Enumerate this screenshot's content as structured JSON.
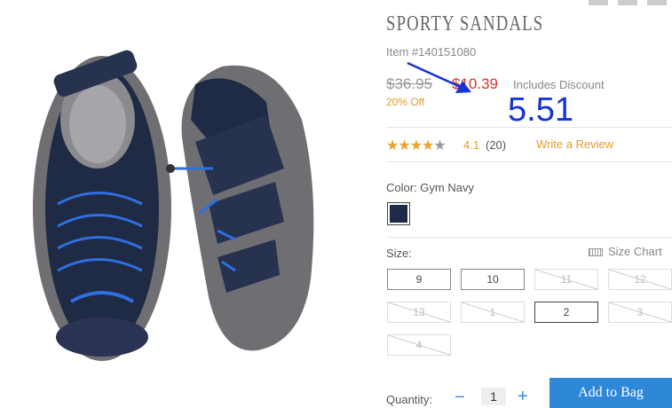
{
  "product": {
    "title": "SPORTY SANDALS",
    "item_number": "Item #140151080",
    "original_price": "$36.95",
    "sale_price": "$10.39",
    "discount_note": "Includes Discount",
    "percent_off": "20% Off",
    "rating_value": "4.1",
    "rating_count": "(20)",
    "rating_fraction": 0.82,
    "write_review_label": "Write a Review"
  },
  "annotation": {
    "text": "5.51",
    "color": "#1533d6"
  },
  "color": {
    "label": "Color: Gym Navy",
    "swatch_hex": "#1e2a48"
  },
  "sizes": {
    "label": "Size:",
    "chart_label": "Size Chart",
    "options": [
      {
        "label": "9",
        "available": true
      },
      {
        "label": "10",
        "available": true
      },
      {
        "label": "11",
        "available": false
      },
      {
        "label": "12",
        "available": false
      },
      {
        "label": "13",
        "available": false
      },
      {
        "label": "1",
        "available": false
      },
      {
        "label": "2",
        "available": true,
        "selected": true
      },
      {
        "label": "3",
        "available": false
      },
      {
        "label": "4",
        "available": false
      }
    ]
  },
  "quantity": {
    "label": "Quantity:",
    "minus": "−",
    "value": "1",
    "plus": "+"
  },
  "cart": {
    "add_label": "Add to Bag"
  },
  "colors": {
    "accent_orange": "#e49b2d",
    "sale_red": "#d9322b",
    "button_blue": "#2f87d8"
  }
}
